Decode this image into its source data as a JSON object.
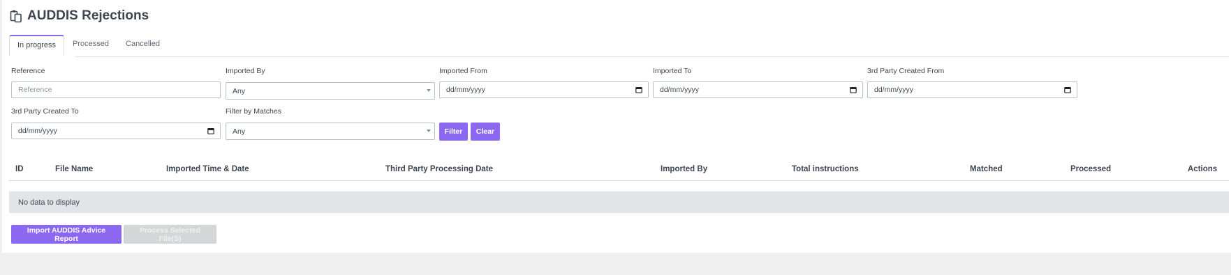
{
  "page": {
    "title": "AUDDIS Rejections",
    "title_icon": "clipboard-copy-icon"
  },
  "tabs": [
    {
      "label": "In progress",
      "active": true
    },
    {
      "label": "Processed",
      "active": false
    },
    {
      "label": "Cancelled",
      "active": false
    }
  ],
  "filters": {
    "reference": {
      "label": "Reference",
      "placeholder": "Reference"
    },
    "imported_by": {
      "label": "Imported By",
      "value": "Any"
    },
    "imported_from": {
      "label": "Imported From",
      "value": "dd/mm/yyyy"
    },
    "imported_to": {
      "label": "Imported To",
      "value": "dd/mm/yyyy"
    },
    "third_party_created_from": {
      "label": "3rd Party Created From",
      "value": "dd/mm/yyyy"
    },
    "third_party_created_to": {
      "label": "3rd Party Created To",
      "value": "dd/mm/yyyy"
    },
    "filter_by_matches": {
      "label": "Filter by Matches",
      "value": "Any"
    },
    "filter_button": "Filter",
    "clear_button": "Clear"
  },
  "table": {
    "columns": [
      "ID",
      "File Name",
      "Imported Time & Date",
      "Third Party Processing Date",
      "Imported By",
      "Total instructions",
      "Matched",
      "Processed",
      "Actions"
    ],
    "empty_message": "No data to display"
  },
  "actions": {
    "import_button": "Import AUDDIS Advice Report",
    "process_button": "Process Selected File(S)"
  },
  "colors": {
    "accent": "#8c67ef",
    "disabled": "#d5d6d8",
    "page_background": "#efefef",
    "empty_row": "#e2e5e8"
  }
}
